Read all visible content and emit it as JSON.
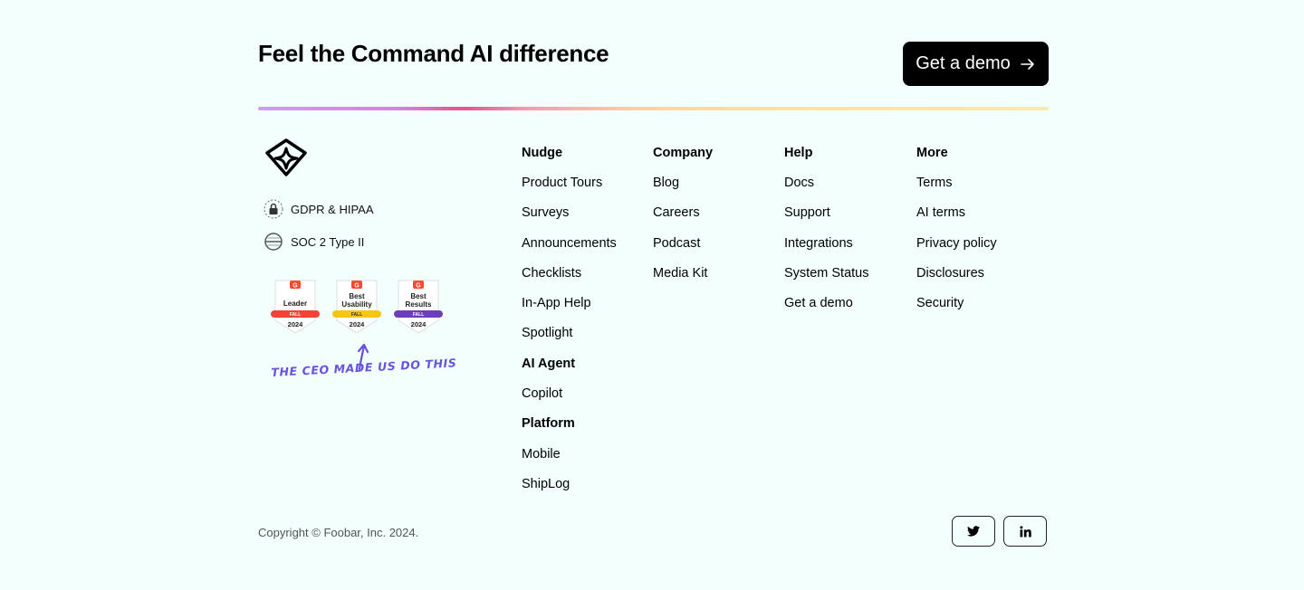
{
  "cta": {
    "title": "Feel the Command AI difference",
    "button_label": "Get a demo"
  },
  "brand": {
    "logo_icon": "command-ai-logo-icon",
    "compliance": [
      {
        "label": "GDPR & HIPAA",
        "icon": "lock-icon"
      },
      {
        "label": "SOC 2 Type II",
        "icon": "soc-badge-icon"
      }
    ],
    "g2_badges": [
      {
        "line1": "Leader",
        "line2": "",
        "season": "FALL",
        "year": "2024",
        "color": "#f04438"
      },
      {
        "line1": "Best",
        "line2": "Usability",
        "season": "FALL",
        "year": "2024",
        "color": "#f5c518"
      },
      {
        "line1": "Best",
        "line2": "Results",
        "season": "FALL",
        "year": "2024",
        "color": "#6c3fb8"
      }
    ],
    "handwritten_note": "The CEO made us do this"
  },
  "columns": {
    "nudge": {
      "heading": "Nudge",
      "links": [
        "Product Tours",
        "Surveys",
        "Announcements",
        "Checklists",
        "In-App Help",
        "Spotlight"
      ],
      "ai_agent_heading": "AI Agent",
      "ai_agent_links": [
        "Copilot"
      ],
      "platform_heading": "Platform",
      "platform_links": [
        "Mobile",
        "ShipLog"
      ]
    },
    "company": {
      "heading": "Company",
      "links": [
        "Blog",
        "Careers",
        "Podcast",
        "Media Kit"
      ]
    },
    "help": {
      "heading": "Help",
      "links": [
        "Docs",
        "Support",
        "Integrations",
        "System Status",
        "Get a demo"
      ]
    },
    "more": {
      "heading": "More",
      "links": [
        "Terms",
        "AI terms",
        "Privacy policy",
        "Disclosures",
        "Security"
      ]
    }
  },
  "footer": {
    "copyright": "Copyright © Foobar, Inc. 2024.",
    "social": [
      {
        "icon": "twitter-icon"
      },
      {
        "icon": "linkedin-icon"
      }
    ]
  },
  "colors": {
    "background": "#f3fffd",
    "note_purple": "#6a52e0"
  }
}
